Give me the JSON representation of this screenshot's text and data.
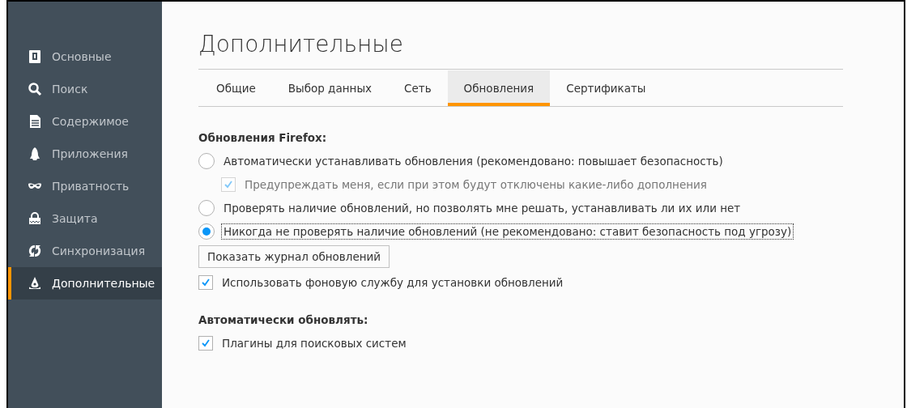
{
  "sidebar": {
    "items": [
      {
        "label": "Основные",
        "selected": false
      },
      {
        "label": "Поиск",
        "selected": false
      },
      {
        "label": "Содержимое",
        "selected": false
      },
      {
        "label": "Приложения",
        "selected": false
      },
      {
        "label": "Приватность",
        "selected": false
      },
      {
        "label": "Защита",
        "selected": false
      },
      {
        "label": "Синхронизация",
        "selected": false
      },
      {
        "label": "Дополнительные",
        "selected": true
      }
    ]
  },
  "page_title": "Дополнительные",
  "tabs": [
    {
      "label": "Общие",
      "selected": false
    },
    {
      "label": "Выбор данных",
      "selected": false
    },
    {
      "label": "Сеть",
      "selected": false
    },
    {
      "label": "Обновления",
      "selected": true
    },
    {
      "label": "Сертификаты",
      "selected": false
    }
  ],
  "sections": [
    {
      "heading": "Обновления Firefox:",
      "items": [
        {
          "kind": "radio",
          "label": "Автоматически устанавливать обновления (рекомендовано: повышает безопасность)",
          "selected": false,
          "focused": false
        },
        {
          "kind": "checkbox",
          "label": "Предупреждать меня, если при этом будут отключены какие-либо дополнения",
          "checked": true,
          "disabled": true,
          "indented": true
        },
        {
          "kind": "radio",
          "label": "Проверять наличие обновлений, но позволять мне решать, устанавливать ли их или нет",
          "selected": false,
          "focused": false
        },
        {
          "kind": "radio",
          "label": "Никогда не проверять наличие обновлений (не рекомендовано: ставит безопасность под угрозу)",
          "selected": true,
          "focused": true
        },
        {
          "kind": "button",
          "label": "Показать журнал обновлений"
        },
        {
          "kind": "checkbox",
          "label": "Использовать фоновую службу для установки обновлений",
          "checked": true,
          "disabled": false,
          "indented": false
        }
      ]
    },
    {
      "heading": "Автоматически обновлять:",
      "items": [
        {
          "kind": "checkbox",
          "label": "Плагины для поисковых систем",
          "checked": true,
          "disabled": false,
          "indented": false
        }
      ]
    }
  ]
}
